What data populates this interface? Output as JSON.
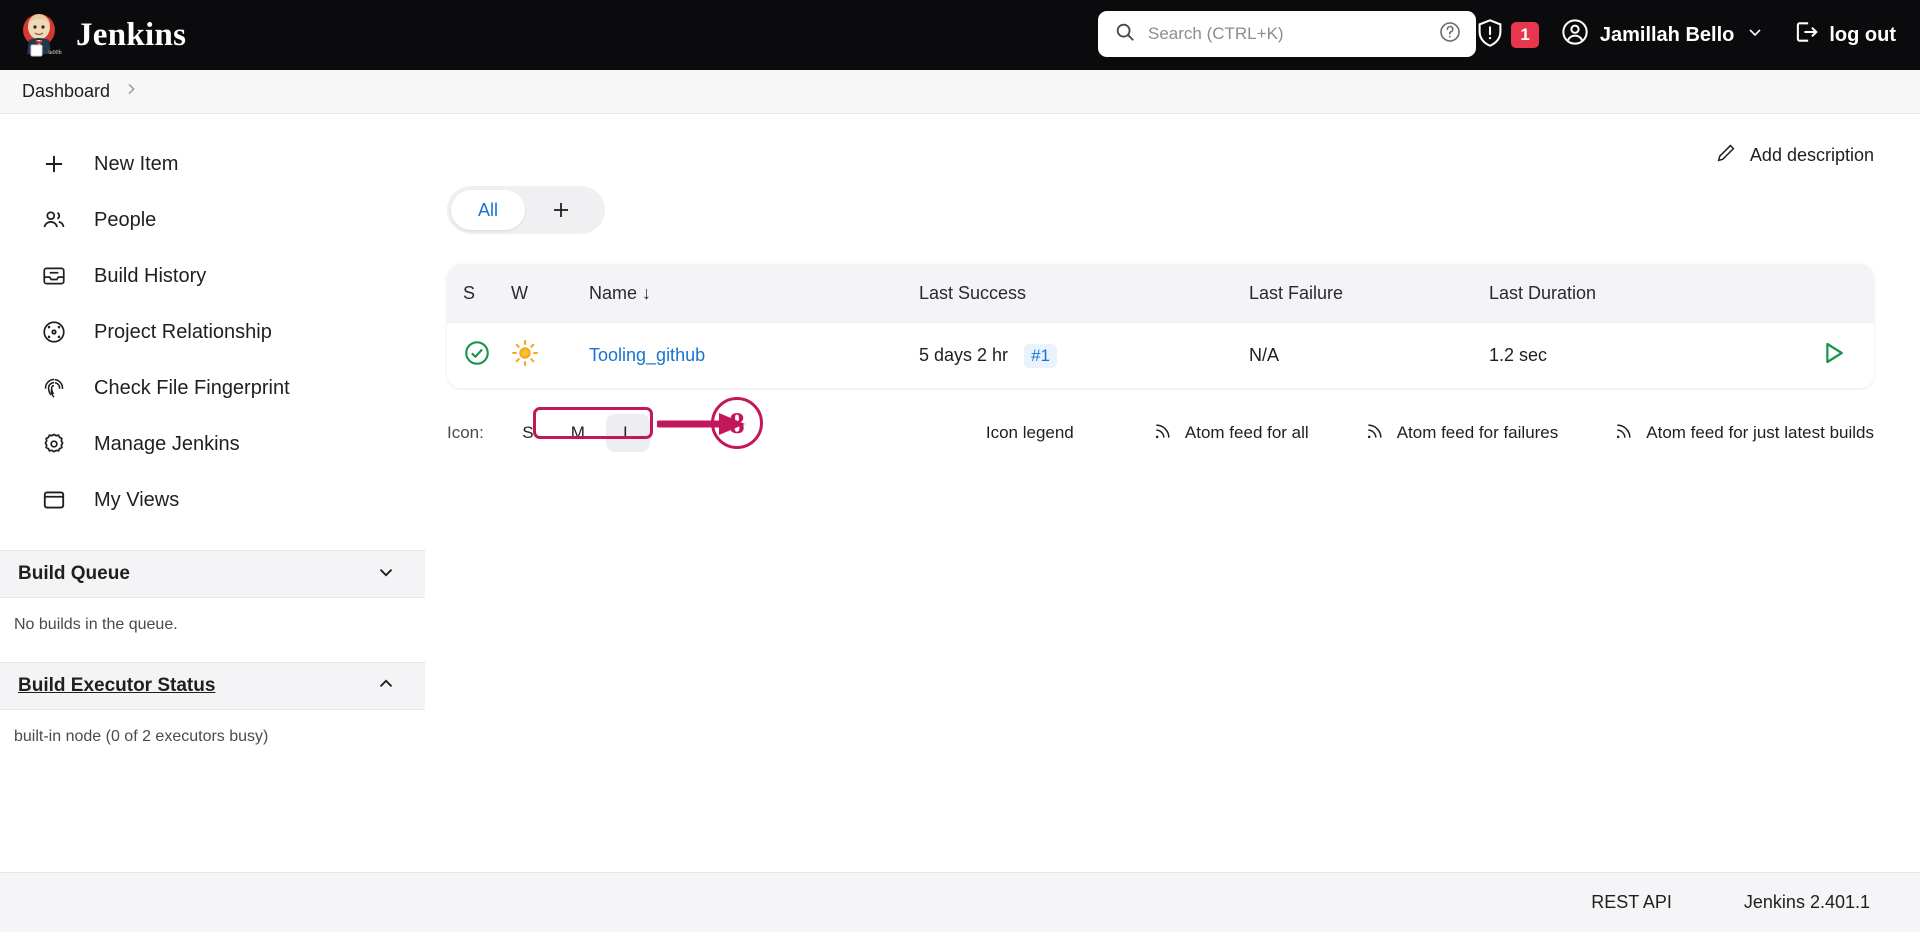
{
  "header": {
    "brand": "Jenkins",
    "search_placeholder": "Search (CTRL+K)",
    "help_icon": "help-circle-icon",
    "security_icon": "shield-warning-icon",
    "security_badge": "1",
    "user_name": "Jamillah Bello",
    "logout_label": "log out"
  },
  "breadcrumb": {
    "items": [
      {
        "label": "Dashboard"
      }
    ],
    "separator": "›"
  },
  "sidebar": {
    "items": [
      {
        "label": "New Item",
        "icon": "plus-icon"
      },
      {
        "label": "People",
        "icon": "people-icon"
      },
      {
        "label": "Build History",
        "icon": "inbox-icon"
      },
      {
        "label": "Project Relationship",
        "icon": "target-circle-icon"
      },
      {
        "label": "Check File Fingerprint",
        "icon": "fingerprint-icon"
      },
      {
        "label": "Manage Jenkins",
        "icon": "gear-icon"
      },
      {
        "label": "My Views",
        "icon": "window-icon"
      }
    ],
    "build_queue": {
      "title": "Build Queue",
      "toggle_icon": "chevron-down-icon",
      "empty_text": "No builds in the queue."
    },
    "build_executor": {
      "title": "Build Executor Status",
      "toggle_icon": "chevron-up-icon",
      "status_text": "built-in node (0 of 2 executors busy)"
    }
  },
  "main": {
    "add_description": {
      "label": "Add description",
      "icon": "pencil-icon"
    },
    "tabs": {
      "items": [
        {
          "label": "All",
          "active": true
        }
      ],
      "add_label": "+"
    },
    "table": {
      "headers": {
        "status": "S",
        "weather": "W",
        "name": "Name",
        "name_sort": "↓",
        "last_success": "Last Success",
        "last_failure": "Last Failure",
        "last_duration": "Last Duration"
      },
      "rows": [
        {
          "status_icon": "check-circle-icon",
          "weather_icon": "sunny-icon",
          "name": "Tooling_github",
          "last_success": "5 days 2 hr",
          "last_success_build": "#1",
          "last_failure": "N/A",
          "last_duration": "1.2 sec",
          "run_icon": "play-triangle-icon"
        }
      ]
    },
    "footer_controls": {
      "icon_label": "Icon:",
      "sizes": [
        {
          "label": "S",
          "active": false
        },
        {
          "label": "M",
          "active": false
        },
        {
          "label": "L",
          "active": true
        }
      ],
      "legend_label": "Icon legend",
      "feeds": [
        {
          "label": "Atom feed for all",
          "icon": "rss-icon"
        },
        {
          "label": "Atom feed for failures",
          "icon": "rss-icon"
        },
        {
          "label": "Atom feed for just latest builds",
          "icon": "rss-icon"
        }
      ]
    },
    "annotations": {
      "highlight_target": "Tooling_github",
      "step_number": "8",
      "color": "#c2185b"
    }
  },
  "footer": {
    "rest_api": "REST API",
    "version": "Jenkins 2.401.1"
  }
}
